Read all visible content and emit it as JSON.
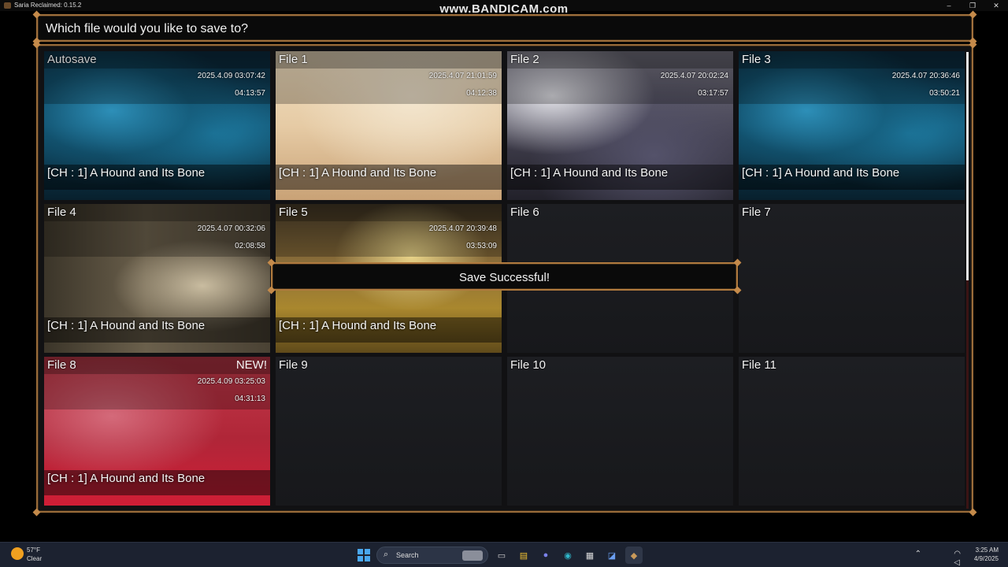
{
  "window": {
    "title": "Saria Reclaimed: 0.15.2",
    "watermark": "www.BANDICAM.com",
    "controls": [
      "–",
      "❐",
      "✕"
    ]
  },
  "prompt": {
    "text": "Which file would you like to save to?"
  },
  "toast": {
    "text": "Save Successful!"
  },
  "slots": [
    {
      "name": "Autosave",
      "date": "2025.4.09 03:07:42",
      "time": "04:13:57",
      "chapter": "[CH : 1] A Hound and Its Bone",
      "art": "cave"
    },
    {
      "name": "File 1",
      "date": "2025.4.07 21:01:59",
      "time": "04:12:38",
      "chapter": "[CH : 1] A Hound and Its Bone",
      "art": "sand"
    },
    {
      "name": "File 2",
      "date": "2025.4.07 20:02:24",
      "time": "03:17:57",
      "chapter": "[CH : 1] A Hound and Its Bone",
      "art": "web"
    },
    {
      "name": "File 3",
      "date": "2025.4.07 20:36:46",
      "time": "03:50:21",
      "chapter": "[CH : 1] A Hound and Its Bone",
      "art": "cave"
    },
    {
      "name": "File 4",
      "date": "2025.4.07 00:32:06",
      "time": "02:08:58",
      "chapter": "[CH : 1] A Hound and Its Bone",
      "art": "hall"
    },
    {
      "name": "File 5",
      "date": "2025.4.07 20:39:48",
      "time": "03:53:09",
      "chapter": "[CH : 1] A Hound and Its Bone",
      "art": "castle"
    },
    {
      "name": "File 6"
    },
    {
      "name": "File 7"
    },
    {
      "name": "File 8",
      "badge": "NEW!",
      "date": "2025.4.09 03:25:03",
      "time": "04:31:13",
      "chapter": "[CH : 1] A Hound and Its Bone",
      "art": "red"
    },
    {
      "name": "File 9"
    },
    {
      "name": "File 10"
    },
    {
      "name": "File 11"
    }
  ],
  "taskbar": {
    "weather_temp": "57°F",
    "weather_cond": "Clear",
    "search_label": "Search",
    "search_icon": "⌕",
    "apps": [
      {
        "icon": "▭",
        "name": "task-view",
        "color": "#cfcfcf"
      },
      {
        "icon": "▤",
        "name": "file-explorer",
        "color": "#f2c230"
      },
      {
        "icon": "●",
        "name": "teams",
        "color": "#7b83eb"
      },
      {
        "icon": "◉",
        "name": "edge",
        "color": "#2fb5c8"
      },
      {
        "icon": "▦",
        "name": "store",
        "color": "#dadada"
      },
      {
        "icon": "◪",
        "name": "visual-studio",
        "color": "#6a9ef0"
      },
      {
        "icon": "◆",
        "name": "game",
        "color": "#c99a5a"
      }
    ],
    "tray_chevron": "⌃",
    "tray_icons": "◠ ◁ ▯",
    "clock_time": "3:25 AM",
    "clock_date": "4/9/2025"
  }
}
